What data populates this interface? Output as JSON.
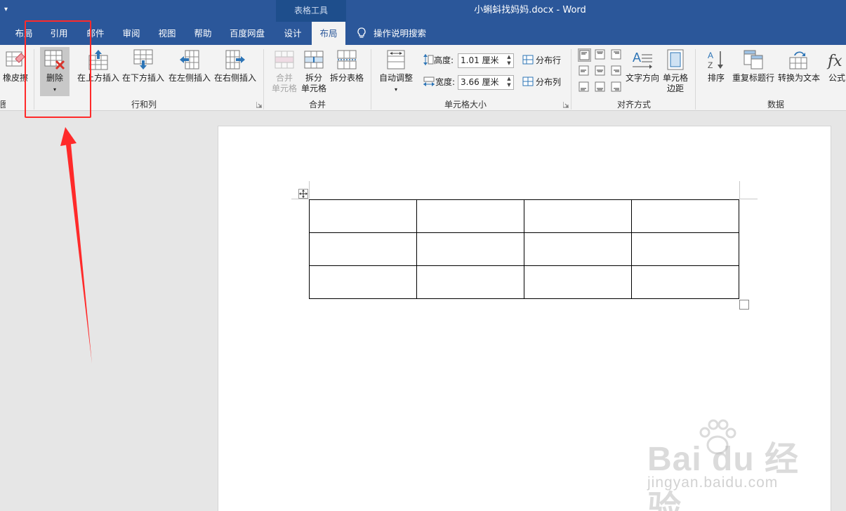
{
  "window": {
    "quick_access_glyph": "▾",
    "context_group": "表格工具",
    "title": "小蝌蚪找妈妈.docx  -  Word"
  },
  "tabs": [
    {
      "label": "布局",
      "active": false
    },
    {
      "label": "引用",
      "active": false
    },
    {
      "label": "邮件",
      "active": false
    },
    {
      "label": "审阅",
      "active": false
    },
    {
      "label": "视图",
      "active": false
    },
    {
      "label": "帮助",
      "active": false
    },
    {
      "label": "百度网盘",
      "active": false
    },
    {
      "label": "设计",
      "active": false
    },
    {
      "label": "布局",
      "active": true
    }
  ],
  "tell_me": "操作说明搜索",
  "ribbon": {
    "draw_group": {
      "eraser": "橡皮擦",
      "label_partial": "图"
    },
    "rows_cols": {
      "label": "行和列",
      "delete": "删除",
      "insert_above": "在上方插入",
      "insert_below": "在下方插入",
      "insert_left": "在左侧插入",
      "insert_right": "在右侧插入"
    },
    "merge": {
      "label": "合并",
      "merge_cells_1": "合并",
      "merge_cells_2": "单元格",
      "split_cells_1": "拆分",
      "split_cells_2": "单元格",
      "split_table": "拆分表格"
    },
    "cell_size": {
      "label": "单元格大小",
      "autofit": "自动调整",
      "height_label": "高度:",
      "height_value": "1.01 厘米",
      "width_label": "宽度:",
      "width_value": "3.66 厘米",
      "distribute_rows": "分布行",
      "distribute_cols": "分布列"
    },
    "alignment": {
      "label": "对齐方式",
      "text_direction": "文字方向",
      "cell_margins_1": "单元格",
      "cell_margins_2": "边距"
    },
    "data": {
      "label": "数据",
      "sort": "排序",
      "repeat_header": "重复标题行",
      "convert_to_text": "转换为文本",
      "formula": "公式"
    }
  },
  "document": {
    "table": {
      "rows": 3,
      "cols": 4
    }
  },
  "watermark": {
    "logo": "Bai du 经验",
    "subtitle": "jingyan.baidu.com"
  },
  "colors": {
    "accent": "#2b579a",
    "annotation": "#ff2a2a"
  }
}
